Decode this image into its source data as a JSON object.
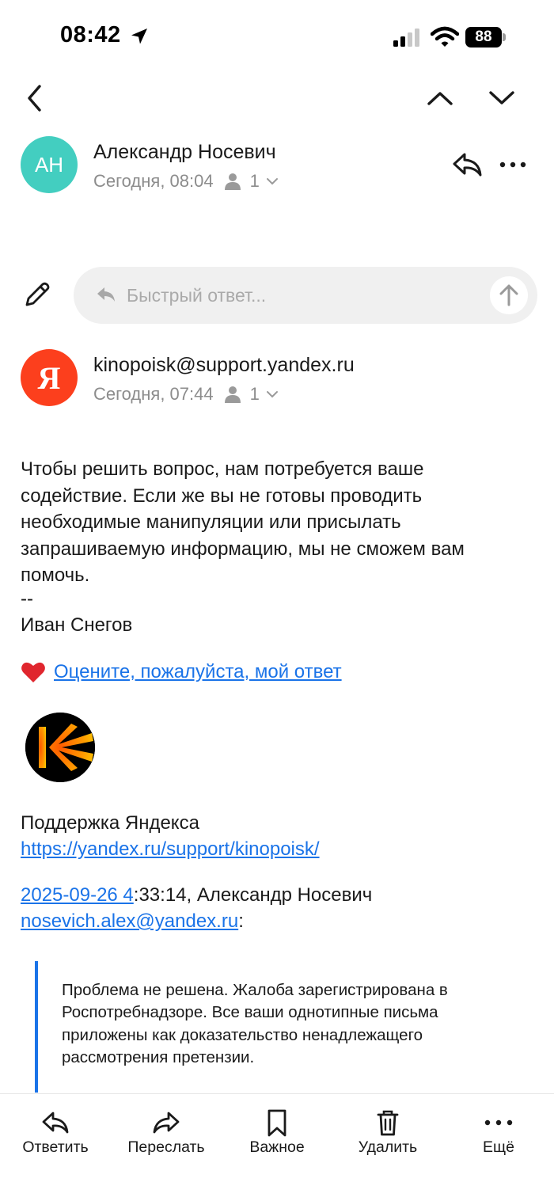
{
  "status_bar": {
    "time": "08:42",
    "battery": "88"
  },
  "thread_messages": [
    {
      "avatar_initials": "АН",
      "sender": "Александр Носевич",
      "time": "Сегодня, 08:04",
      "recipients_count": "1"
    },
    {
      "avatar_letter": "Я",
      "sender": "kinopoisk@support.yandex.ru",
      "time": "Сегодня, 07:44",
      "recipients_count": "1"
    }
  ],
  "quick_reply": {
    "placeholder": "Быстрый ответ..."
  },
  "message": {
    "body": "Чтобы решить вопрос, нам потребуется ваше содействие. Если же вы не готовы проводить необходимые манипуляции или присылать запрашиваемую информацию, мы не сможем вам помочь.",
    "signature_dash": "--",
    "signature_name": "Иван Снегов",
    "rate_link": "Оцените, пожалуйста, мой ответ",
    "support_team": "Поддержка Яндекса",
    "support_url": "https://yandex.ru/support/kinopoisk/",
    "quote_date_link": "2025-09-26 4",
    "quote_header_rest": ":33:14, Александр Носевич",
    "quote_email": "nosevich.alex@yandex.ru",
    "quote_email_suffix": ":",
    "quoted_text": "Проблема не решена. Жалоба зарегистрирована в Роспотребнадзоре. Все ваши однотипные письма приложены как доказательство ненадлежащего рассмотрения претензии."
  },
  "toolbar": {
    "reply": "Ответить",
    "forward": "Переслать",
    "important": "Важное",
    "delete": "Удалить",
    "more": "Ещё"
  },
  "colors": {
    "avatar_ah": "#43cec0",
    "avatar_yandex": "#fc3f1d",
    "link": "#1a73e8"
  }
}
